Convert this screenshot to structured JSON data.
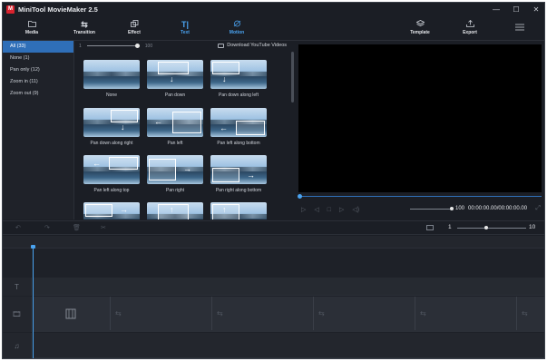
{
  "window": {
    "title": "MiniTool MovieMaker 2.5",
    "logo_letter": "M",
    "controls": [
      "—",
      "☐",
      "✕"
    ]
  },
  "toolbar": {
    "tools": [
      {
        "label": "Media",
        "icon": "folder-icon"
      },
      {
        "label": "Transition",
        "icon": "transition-icon"
      },
      {
        "label": "Effect",
        "icon": "effect-icon"
      },
      {
        "label": "Text",
        "icon": "text-icon"
      },
      {
        "label": "Motion",
        "icon": "motion-icon"
      },
      {
        "label": "Template",
        "icon": "layers-icon"
      },
      {
        "label": "Export",
        "icon": "upload-icon"
      }
    ],
    "active_tool": "Motion",
    "menu_icon": "hamburger-icon"
  },
  "categories": [
    {
      "label": "All (33)",
      "selected": true
    },
    {
      "label": "None (1)",
      "selected": false
    },
    {
      "label": "Pan only (12)",
      "selected": false
    },
    {
      "label": "Zoom in (11)",
      "selected": false
    },
    {
      "label": "Zoom out (9)",
      "selected": false
    }
  ],
  "gallery": {
    "zoom_min": "1",
    "zoom_max": "100",
    "download_label": "Download YouTube Videos",
    "items": [
      {
        "label": "None"
      },
      {
        "label": "Pan down"
      },
      {
        "label": "Pan down along left"
      },
      {
        "label": "Pan down along right"
      },
      {
        "label": "Pan left"
      },
      {
        "label": "Pan left along bottom"
      },
      {
        "label": "Pan left along top"
      },
      {
        "label": "Pan right"
      },
      {
        "label": "Pan right along bottom"
      },
      {
        "label": "",
        "icon": "arrow-right-icon"
      },
      {
        "label": "",
        "icon": "arrow-up-icon"
      },
      {
        "label": "",
        "icon": "arrow-up-icon"
      }
    ]
  },
  "preview": {
    "volume": "100",
    "timecode": "00:00:00.00/00:00:00.00"
  },
  "timeline": {
    "zoom_min": "1",
    "zoom_max": "10",
    "tracks": [
      "text",
      "video",
      "audio"
    ]
  },
  "colors": {
    "accent": "#2f6fb8",
    "active_tool": "#4aa3f0",
    "background": "#1b1e25",
    "brand": "#d9232e"
  }
}
